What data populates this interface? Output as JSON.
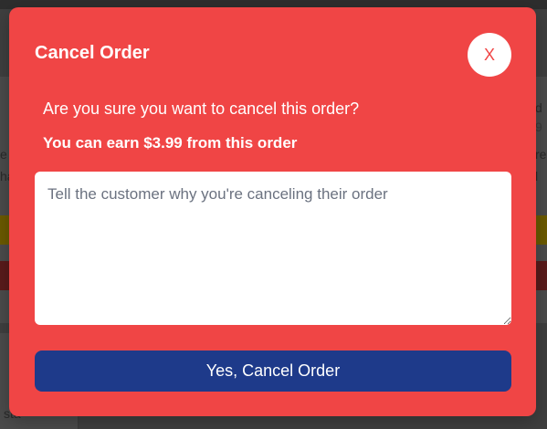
{
  "modal": {
    "title": "Cancel Order",
    "close_label": "X",
    "confirm_text": "Are you sure you want to cancel this order?",
    "earn_text": "You can earn $3.99 from this order",
    "reason_placeholder": "Tell the customer why you're canceling their order",
    "reason_value": "",
    "submit_label": "Yes, Cancel Order"
  },
  "background": {
    "left_line_1": "e",
    "left_line_2": "ha",
    "left_bottom": "sta",
    "right_line_1": "d",
    "right_line_2": "9",
    "right_line_3": "re",
    "right_line_4": "l"
  },
  "colors": {
    "modal_background": "#f04545",
    "primary_button": "#1e3a8a",
    "text": "#ffffff"
  }
}
